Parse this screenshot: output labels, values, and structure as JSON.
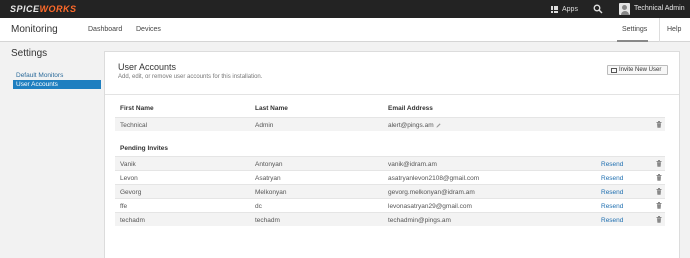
{
  "topbar": {
    "logo_part1": "SPICE",
    "logo_part2": "WORKS",
    "apps_label": "Apps",
    "user_name": "Technical Admin",
    "accent_color": "#ff6a2a"
  },
  "navbar": {
    "app_title": "Monitoring",
    "links": {
      "dashboard": "Dashboard",
      "devices": "Devices",
      "settings": "Settings",
      "help": "Help"
    }
  },
  "sidebar": {
    "title": "Settings",
    "items": [
      {
        "label": "Default Monitors",
        "active": false
      },
      {
        "label": "User Accounts",
        "active": true
      }
    ]
  },
  "panel": {
    "title": "User Accounts",
    "subtitle": "Add, edit, or remove user accounts for this installation.",
    "invite_button": "Invite New User",
    "columns": {
      "first": "First Name",
      "last": "Last Name",
      "email": "Email Address"
    },
    "users": [
      {
        "first": "Technical",
        "last": "Admin",
        "email": "alert@pings.am"
      }
    ],
    "pending_heading": "Pending Invites",
    "resend_label": "Resend",
    "pending": [
      {
        "first": "Vanik",
        "last": "Antonyan",
        "email": "vanik@idram.am"
      },
      {
        "first": "Levon",
        "last": "Asatryan",
        "email": "asatryanlevon2108@gmail.com"
      },
      {
        "first": "Gevorg",
        "last": "Melkonyan",
        "email": "gevorg.melkonyan@idram.am"
      },
      {
        "first": "ffe",
        "last": "dc",
        "email": "levonasatryan29@gmail.com"
      },
      {
        "first": "techadm",
        "last": "techadm",
        "email": "techadmin@pings.am"
      }
    ]
  }
}
